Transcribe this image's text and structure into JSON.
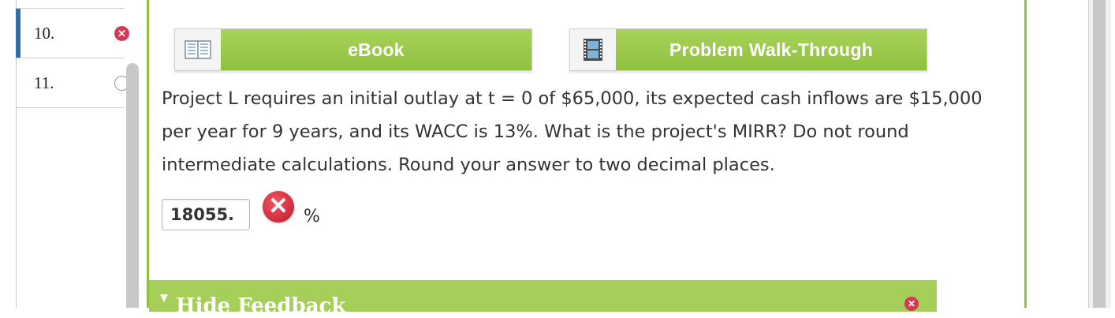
{
  "question_list": [
    {
      "number": "10.",
      "status": "incorrect",
      "status_icon": "x-circle-icon"
    },
    {
      "number": "11.",
      "status": "unanswered",
      "status_icon": "empty-circle-icon"
    }
  ],
  "resources": {
    "ebook_label": "eBook",
    "walkthrough_label": "Problem Walk-Through"
  },
  "question": {
    "text": "Project L requires an initial outlay at t = 0 of $65,000, its expected cash inflows are $15,000 per year for 9 years, and its WACC is 13%. What is the project's MIRR? Do not round intermediate calculations. Round your answer to two decimal places."
  },
  "answer": {
    "value": "18055.",
    "unit": "%",
    "result": "incorrect"
  },
  "feedback": {
    "title": "Hide Feedback"
  },
  "colors": {
    "accent_green": "#8fc13e",
    "button_green": "#a9d25a",
    "error_red": "#d33b54",
    "active_blue": "#2f6ea6"
  }
}
